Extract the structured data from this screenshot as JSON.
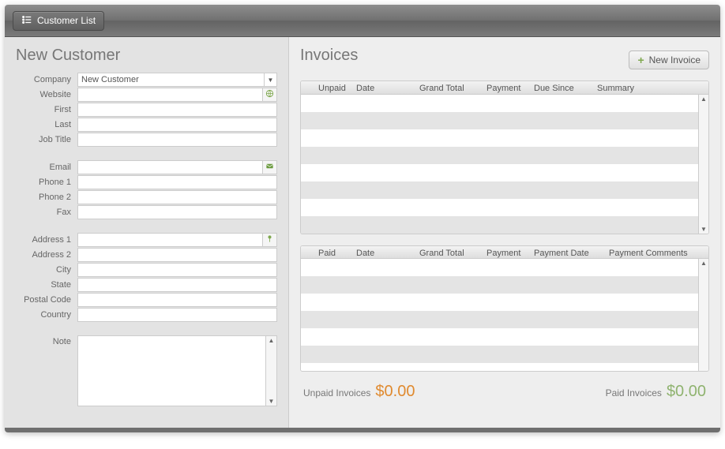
{
  "toolbar": {
    "customer_list_label": "Customer List"
  },
  "customer": {
    "title": "New Customer",
    "labels": {
      "company": "Company",
      "website": "Website",
      "first": "First",
      "last": "Last",
      "job_title": "Job Title",
      "email": "Email",
      "phone1": "Phone 1",
      "phone2": "Phone 2",
      "fax": "Fax",
      "address1": "Address 1",
      "address2": "Address 2",
      "city": "City",
      "state": "State",
      "postal": "Postal Code",
      "country": "Country",
      "note": "Note"
    },
    "values": {
      "company": "New Customer",
      "website": "",
      "first": "",
      "last": "",
      "job_title": "",
      "email": "",
      "phone1": "",
      "phone2": "",
      "fax": "",
      "address1": "",
      "address2": "",
      "city": "",
      "state": "",
      "postal": "",
      "country": "",
      "note": ""
    }
  },
  "invoices": {
    "title": "Invoices",
    "new_button": "New Invoice",
    "unpaid_headers": [
      "Unpaid",
      "Date",
      "Grand Total",
      "Payment",
      "Due Since",
      "Summary"
    ],
    "paid_headers": [
      "Paid",
      "Date",
      "Grand Total",
      "Payment",
      "Payment Date",
      "Payment Comments"
    ],
    "totals": {
      "unpaid_label": "Unpaid Invoices",
      "unpaid_amount": "$0.00",
      "paid_label": "Paid Invoices",
      "paid_amount": "$0.00"
    }
  }
}
